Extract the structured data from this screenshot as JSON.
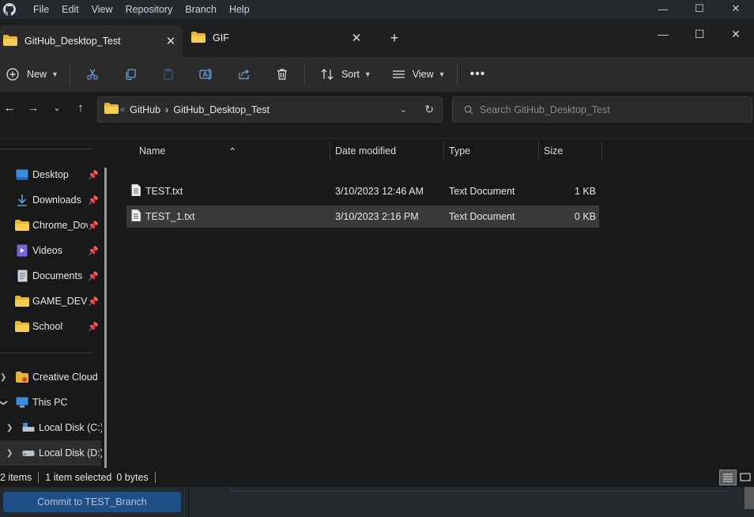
{
  "github_desktop": {
    "menu": [
      "File",
      "Edit",
      "View",
      "Repository",
      "Branch",
      "Help"
    ],
    "commit_button": "Commit to TEST_Branch"
  },
  "explorer": {
    "tabs": [
      {
        "label": "GitHub_Desktop_Test",
        "active": true
      },
      {
        "label": "GIF",
        "active": false
      }
    ],
    "toolbar": {
      "new_label": "New",
      "sort_label": "Sort",
      "view_label": "View",
      "more_label": "•••"
    },
    "breadcrumb": [
      "GitHub",
      "GitHub_Desktop_Test"
    ],
    "search": {
      "placeholder": "Search GitHub_Desktop_Test"
    },
    "nav": {
      "quick_access": [
        {
          "label": "Desktop",
          "icon": "desktop-icon"
        },
        {
          "label": "Downloads",
          "icon": "download-icon"
        },
        {
          "label": "Chrome_Dov",
          "icon": "folder-icon"
        },
        {
          "label": "Videos",
          "icon": "video-icon"
        },
        {
          "label": "Documents",
          "icon": "document-icon"
        },
        {
          "label": "GAME_DEVEI",
          "icon": "folder-icon"
        },
        {
          "label": "School",
          "icon": "folder-icon"
        }
      ],
      "tree": [
        {
          "label": "Creative Cloud F",
          "icon": "creative-cloud-icon"
        },
        {
          "label": "This PC",
          "icon": "pc-icon"
        },
        {
          "label": "Local Disk (C:)",
          "icon": "drive-icon"
        },
        {
          "label": "Local Disk (D:)",
          "icon": "drive-icon"
        }
      ]
    },
    "columns": {
      "name": "Name",
      "date": "Date modified",
      "type": "Type",
      "size": "Size"
    },
    "files": [
      {
        "name": "TEST.txt",
        "date": "3/10/2023 12:46 AM",
        "type": "Text Document",
        "size": "1 KB"
      },
      {
        "name": "TEST_1.txt",
        "date": "3/10/2023 2:16 PM",
        "type": "Text Document",
        "size": "0 KB"
      }
    ],
    "status": {
      "count": "2 items",
      "selection": "1 item selected",
      "bytes": "0 bytes"
    }
  },
  "colors": {
    "folder": "#f2c14e",
    "accent_blue": "#1f4f86",
    "bg": "#191919"
  }
}
